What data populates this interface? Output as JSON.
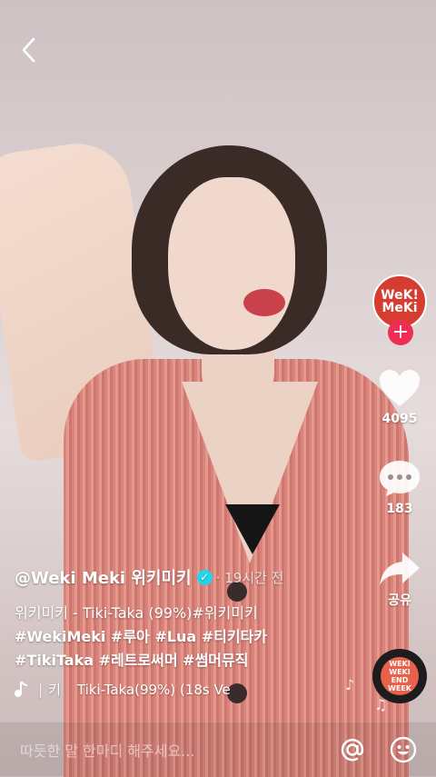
{
  "profile": {
    "avatar_logo_line1": "WeK!",
    "avatar_logo_line2": "MeKi"
  },
  "actions": {
    "like_count": "4095",
    "comment_count": "183",
    "share_label": "공유"
  },
  "caption": {
    "username": "@Weki Meki 위키미키",
    "time": "· 19시간 전",
    "line1": "위키미키 - Tiki-Taka (99%)#위키미키",
    "line2": "#WekiMeki #루아 #Lua #티키타카",
    "line3": "#TikiTaka #레트로써머 #썸머뮤직"
  },
  "music": {
    "artist": "키",
    "title": "Tiki-Taka(99%) (18s Ve"
  },
  "disc": {
    "label": "WEKI WEKI END WEEK"
  },
  "comment_bar": {
    "placeholder": "따듯한 말 한마디 해주세요..."
  },
  "colors": {
    "follow": "#ee2e55",
    "verified": "#20d5ec",
    "avatar": "#d63c2f"
  },
  "icons": [
    "back-icon",
    "heart-icon",
    "comment-icon",
    "share-icon",
    "music-note-icon",
    "at-icon",
    "emoji-icon",
    "verified-icon",
    "plus-icon"
  ]
}
